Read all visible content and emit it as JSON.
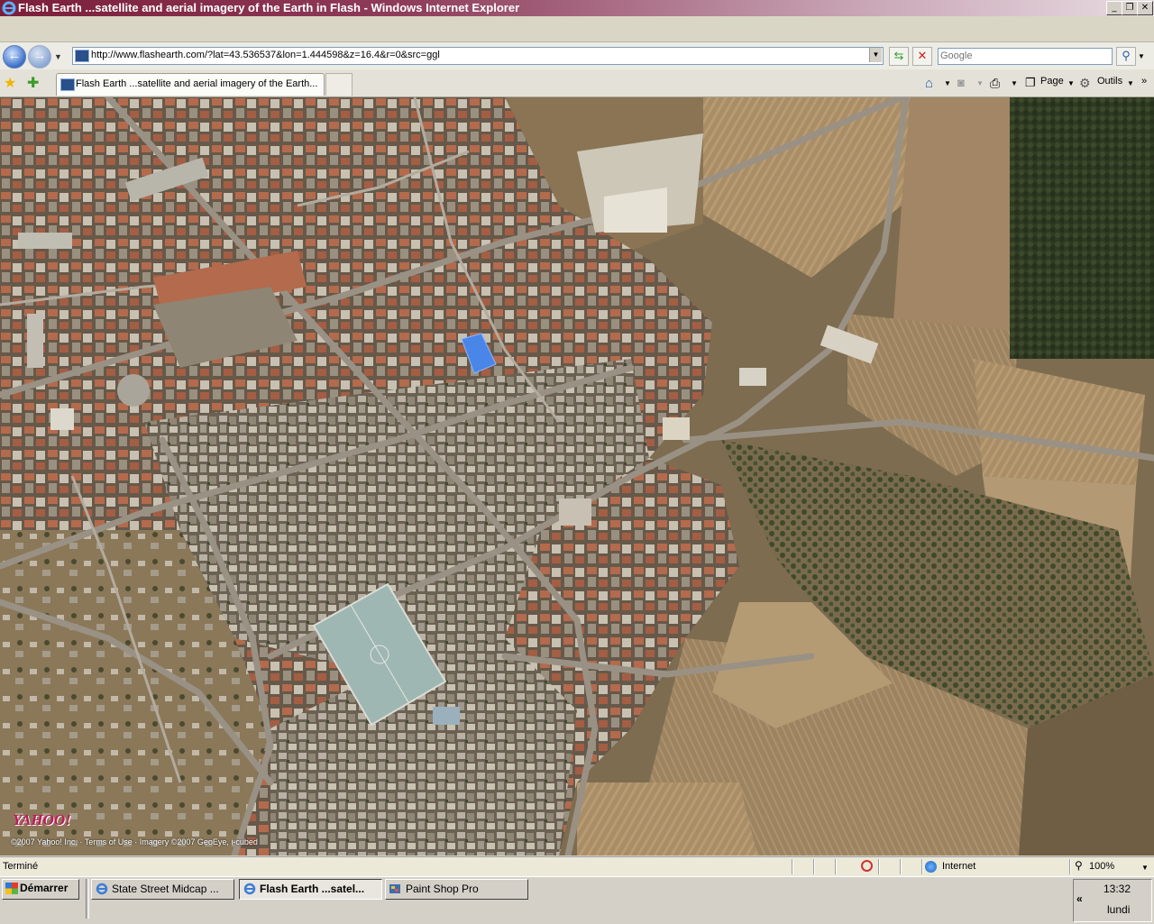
{
  "window": {
    "title": "Flash Earth ...satellite and aerial imagery of the Earth in Flash - Windows Internet Explorer",
    "controls": [
      "_",
      "❐",
      "✕"
    ]
  },
  "navigation": {
    "address": "http://www.flashearth.com/?lat=43.536537&lon=1.444598&z=16.4&r=0&src=ggl",
    "search_placeholder": "Google"
  },
  "tabs": [
    {
      "label": "Flash Earth ...satellite and aerial imagery of the Earth..."
    }
  ],
  "command_bar": {
    "page_label": "Page",
    "tools_label": "Outils"
  },
  "map": {
    "logo": "YAHOO!",
    "copyright": "©2007 Yahoo! Inc. · Terms of Use · Imagery ©2007 GeoEye, i-cubed"
  },
  "status": {
    "text": "Terminé",
    "zone": "Internet",
    "zoom": "100%"
  },
  "taskbar": {
    "start_label": "Démarrer",
    "tasks": [
      {
        "label": "State Street Midcap ..."
      },
      {
        "label": "Flash Earth ...satel..."
      },
      {
        "label": "Paint Shop Pro"
      }
    ],
    "clock_time": "13:32",
    "clock_day": "lundi"
  },
  "colors": {
    "title_bar": "#7b1e3a",
    "map_ground": "#8c7b5e",
    "highlight_building": "#4a86e8"
  }
}
